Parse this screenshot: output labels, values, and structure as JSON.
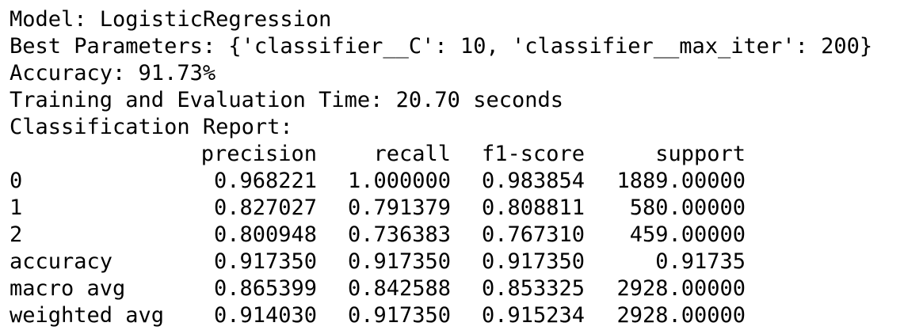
{
  "output": {
    "model_line": "Model: LogisticRegression",
    "params_line": "Best Parameters: {'classifier__C': 10, 'classifier__max_iter': 200}",
    "accuracy_line": "Accuracy: 91.73%",
    "time_line": "Training and Evaluation Time: 20.70 seconds",
    "report_title": "Classification Report:"
  },
  "report": {
    "headers": [
      "",
      "precision",
      "recall",
      "f1-score",
      "support"
    ],
    "rows": [
      {
        "label": "0",
        "precision": "0.968221",
        "recall": "1.000000",
        "f1": "0.983854",
        "support": "1889.00000"
      },
      {
        "label": "1",
        "precision": "0.827027",
        "recall": "0.791379",
        "f1": "0.808811",
        "support": "580.00000"
      },
      {
        "label": "2",
        "precision": "0.800948",
        "recall": "0.736383",
        "f1": "0.767310",
        "support": "459.00000"
      },
      {
        "label": "accuracy",
        "precision": "0.917350",
        "recall": "0.917350",
        "f1": "0.917350",
        "support": "0.91735"
      },
      {
        "label": "macro avg",
        "precision": "0.865399",
        "recall": "0.842588",
        "f1": "0.853325",
        "support": "2928.00000"
      },
      {
        "label": "weighted avg",
        "precision": "0.914030",
        "recall": "0.917350",
        "f1": "0.915234",
        "support": "2928.00000"
      }
    ]
  }
}
